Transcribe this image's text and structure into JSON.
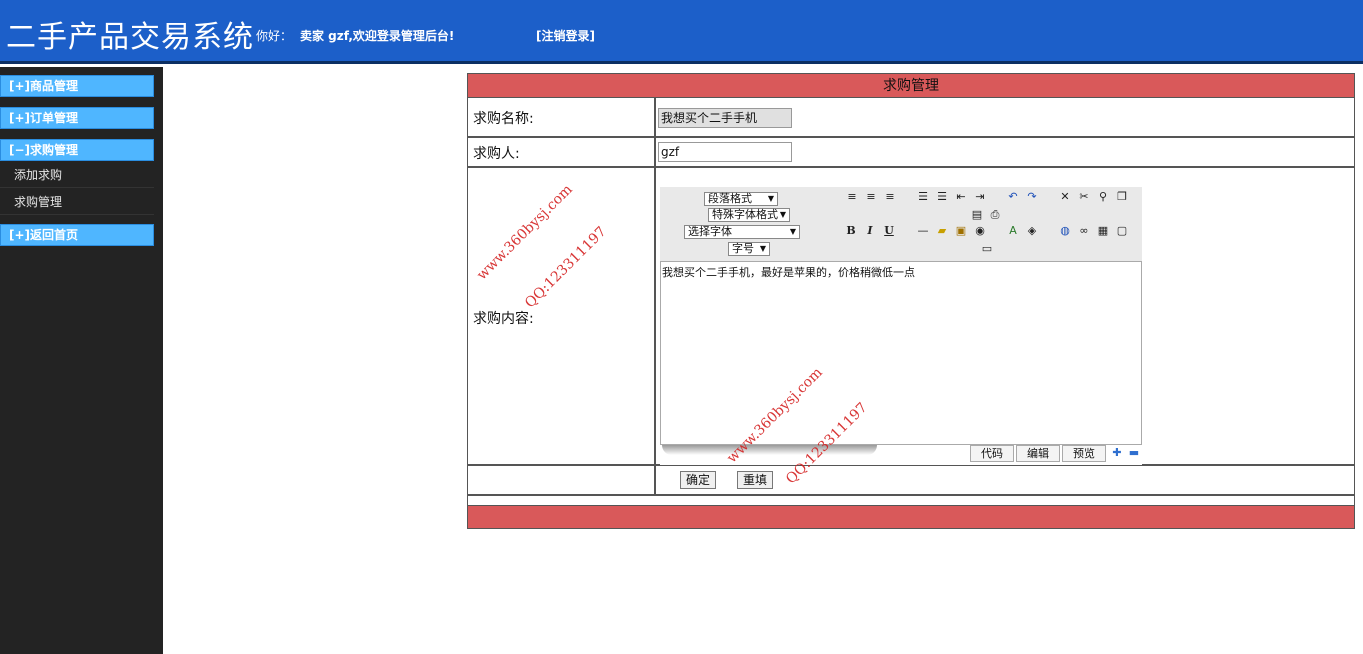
{
  "header": {
    "title": "二手产品交易系统",
    "greeting": "你好：",
    "welcome": "卖家 gzf,欢迎登录管理后台!",
    "logout": "[注销登录]"
  },
  "sidebar": {
    "groups": [
      {
        "label": "[+]商品管理"
      },
      {
        "label": "[+]订单管理"
      },
      {
        "label": "[−]求购管理",
        "items": [
          {
            "label": "添加求购"
          },
          {
            "label": "求购管理"
          }
        ]
      },
      {
        "label": "[+]返回首页"
      }
    ]
  },
  "panel": {
    "title": "求购管理",
    "name_label": "求购名称:",
    "name_value": "我想买个二手手机",
    "person_label": "求购人:",
    "person_value": "gzf",
    "content_label": "求购内容:"
  },
  "editor": {
    "paragraph_select": "段落格式",
    "special_font_select": "特殊字体格式",
    "font_select": "选择字体",
    "size_select": "字号",
    "content": "我想买个二手手机，最好是苹果的，价格稍微低一点",
    "modes": [
      "代码",
      "编辑",
      "预览"
    ]
  },
  "actions": {
    "confirm": "确定",
    "reset": "重填"
  },
  "watermarks": {
    "site": "www.360bysj.com",
    "qq": "QQ:123311197"
  }
}
